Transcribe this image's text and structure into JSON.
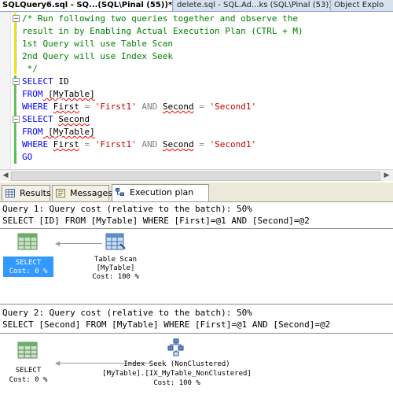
{
  "doc_tabs": [
    {
      "label": "SQLQuery6.sql - SQ...(SQL\\Pinal (55))*",
      "active": true
    },
    {
      "label": "delete.sql - SQL.Ad...ks (SQL\\Pinal (53))",
      "active": false
    },
    {
      "label": "Object Explo",
      "active": false
    }
  ],
  "editor": {
    "comment_lines": [
      "/* Run following two queries together and observe the",
      "result in by Enabling Actual Execution Plan (CTRL + M)",
      "1st Query will use Table Scan",
      "2nd Query will use Index Seek",
      " */"
    ],
    "q1": {
      "select_kw": "SELECT",
      "select_col": " ID",
      "from_kw": "FROM",
      "from_tbl": " [MyTable]",
      "where_kw": "WHERE",
      "col1": "First",
      "eq1": " = ",
      "val1": "'First1'",
      "and_kw": " AND ",
      "col2": "Second",
      "eq2": " = ",
      "val2": "'Second1'"
    },
    "q2": {
      "select_kw": "SELECT",
      "select_col": "Second",
      "from_kw": "FROM",
      "from_tbl": " [MyTable]",
      "where_kw": "WHERE",
      "col1": "First",
      "eq1": " = ",
      "val1": "'First1'",
      "and_kw": " AND ",
      "col2": "Second",
      "eq2": " = ",
      "val2": "'Second1'"
    },
    "go_kw": "GO"
  },
  "result_tabs": [
    {
      "label": "Results",
      "icon": "grid-icon"
    },
    {
      "label": "Messages",
      "icon": "messages-icon"
    },
    {
      "label": "Execution plan",
      "icon": "execution-plan-icon",
      "active": true
    }
  ],
  "plan": {
    "query1": {
      "header": "Query 1: Query cost (relative to the batch): 50%",
      "sql": "SELECT [ID] FROM [MyTable] WHERE [First]=@1 AND [Second]=@2",
      "select_node": {
        "name": "SELECT",
        "cost": "Cost: 0 %"
      },
      "op_node": {
        "line1": "Table Scan",
        "line2": "[MyTable]",
        "cost": "Cost: 100 %"
      }
    },
    "query2": {
      "header": "Query 2: Query cost (relative to the batch): 50%",
      "sql": "SELECT [Second] FROM [MyTable] WHERE [First]=@1 AND [Second]=@2",
      "select_node": {
        "name": "SELECT",
        "cost": "Cost: 0 %"
      },
      "op_node": {
        "line1": "Index Seek (NonClustered)",
        "line2": "[MyTable].[IX_MyTable_NonClustered]",
        "cost": "Cost: 100 %"
      }
    }
  },
  "colors": {
    "keyword": "#0000ff",
    "comment": "#008000",
    "string": "#c00000",
    "selection": "#3399ff"
  }
}
